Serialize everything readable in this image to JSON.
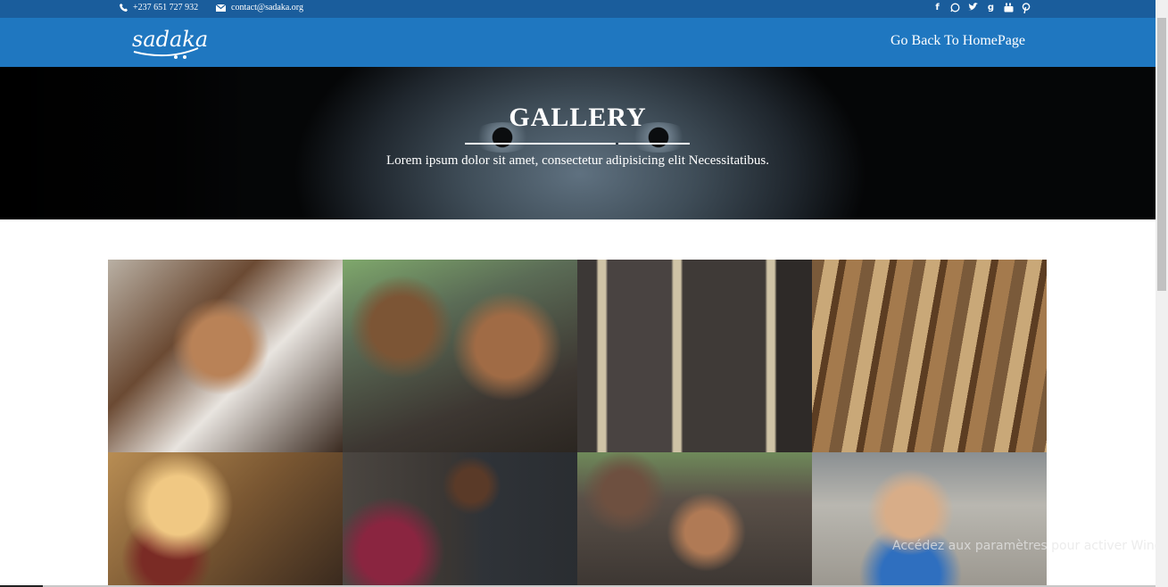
{
  "topbar": {
    "phone": "+237 651 727 932",
    "email": "contact@sadaka.org",
    "social_icons": [
      "facebook-icon",
      "whatsapp-icon",
      "twitter-icon",
      "google-plus-icon",
      "youtube-icon",
      "pinterest-icon"
    ]
  },
  "navbar": {
    "logo_text": "sadaka",
    "back_link": "Go Back To HomePage"
  },
  "hero": {
    "title": "GALLERY",
    "subtitle": "Lorem ipsum dolor sit amet, consectetur adipisicing elit Necessitatibus."
  },
  "gallery": {
    "images": [
      "children-medical-care-photo",
      "two-smiling-children-photo",
      "child-behind-bars-photo",
      "old-books-photo",
      "hands-holding-bread-photo",
      "mother-child-chalkboard-photo",
      "boys-with-cap-photo",
      "smiling-boy-rocks-photo"
    ]
  },
  "os": {
    "activation_watermark": "Accédez aux paramètres pour activer Windows."
  },
  "colors": {
    "topbar": "#1a5d9c",
    "navbar": "#1f77c0",
    "text_light": "#ffffff"
  }
}
